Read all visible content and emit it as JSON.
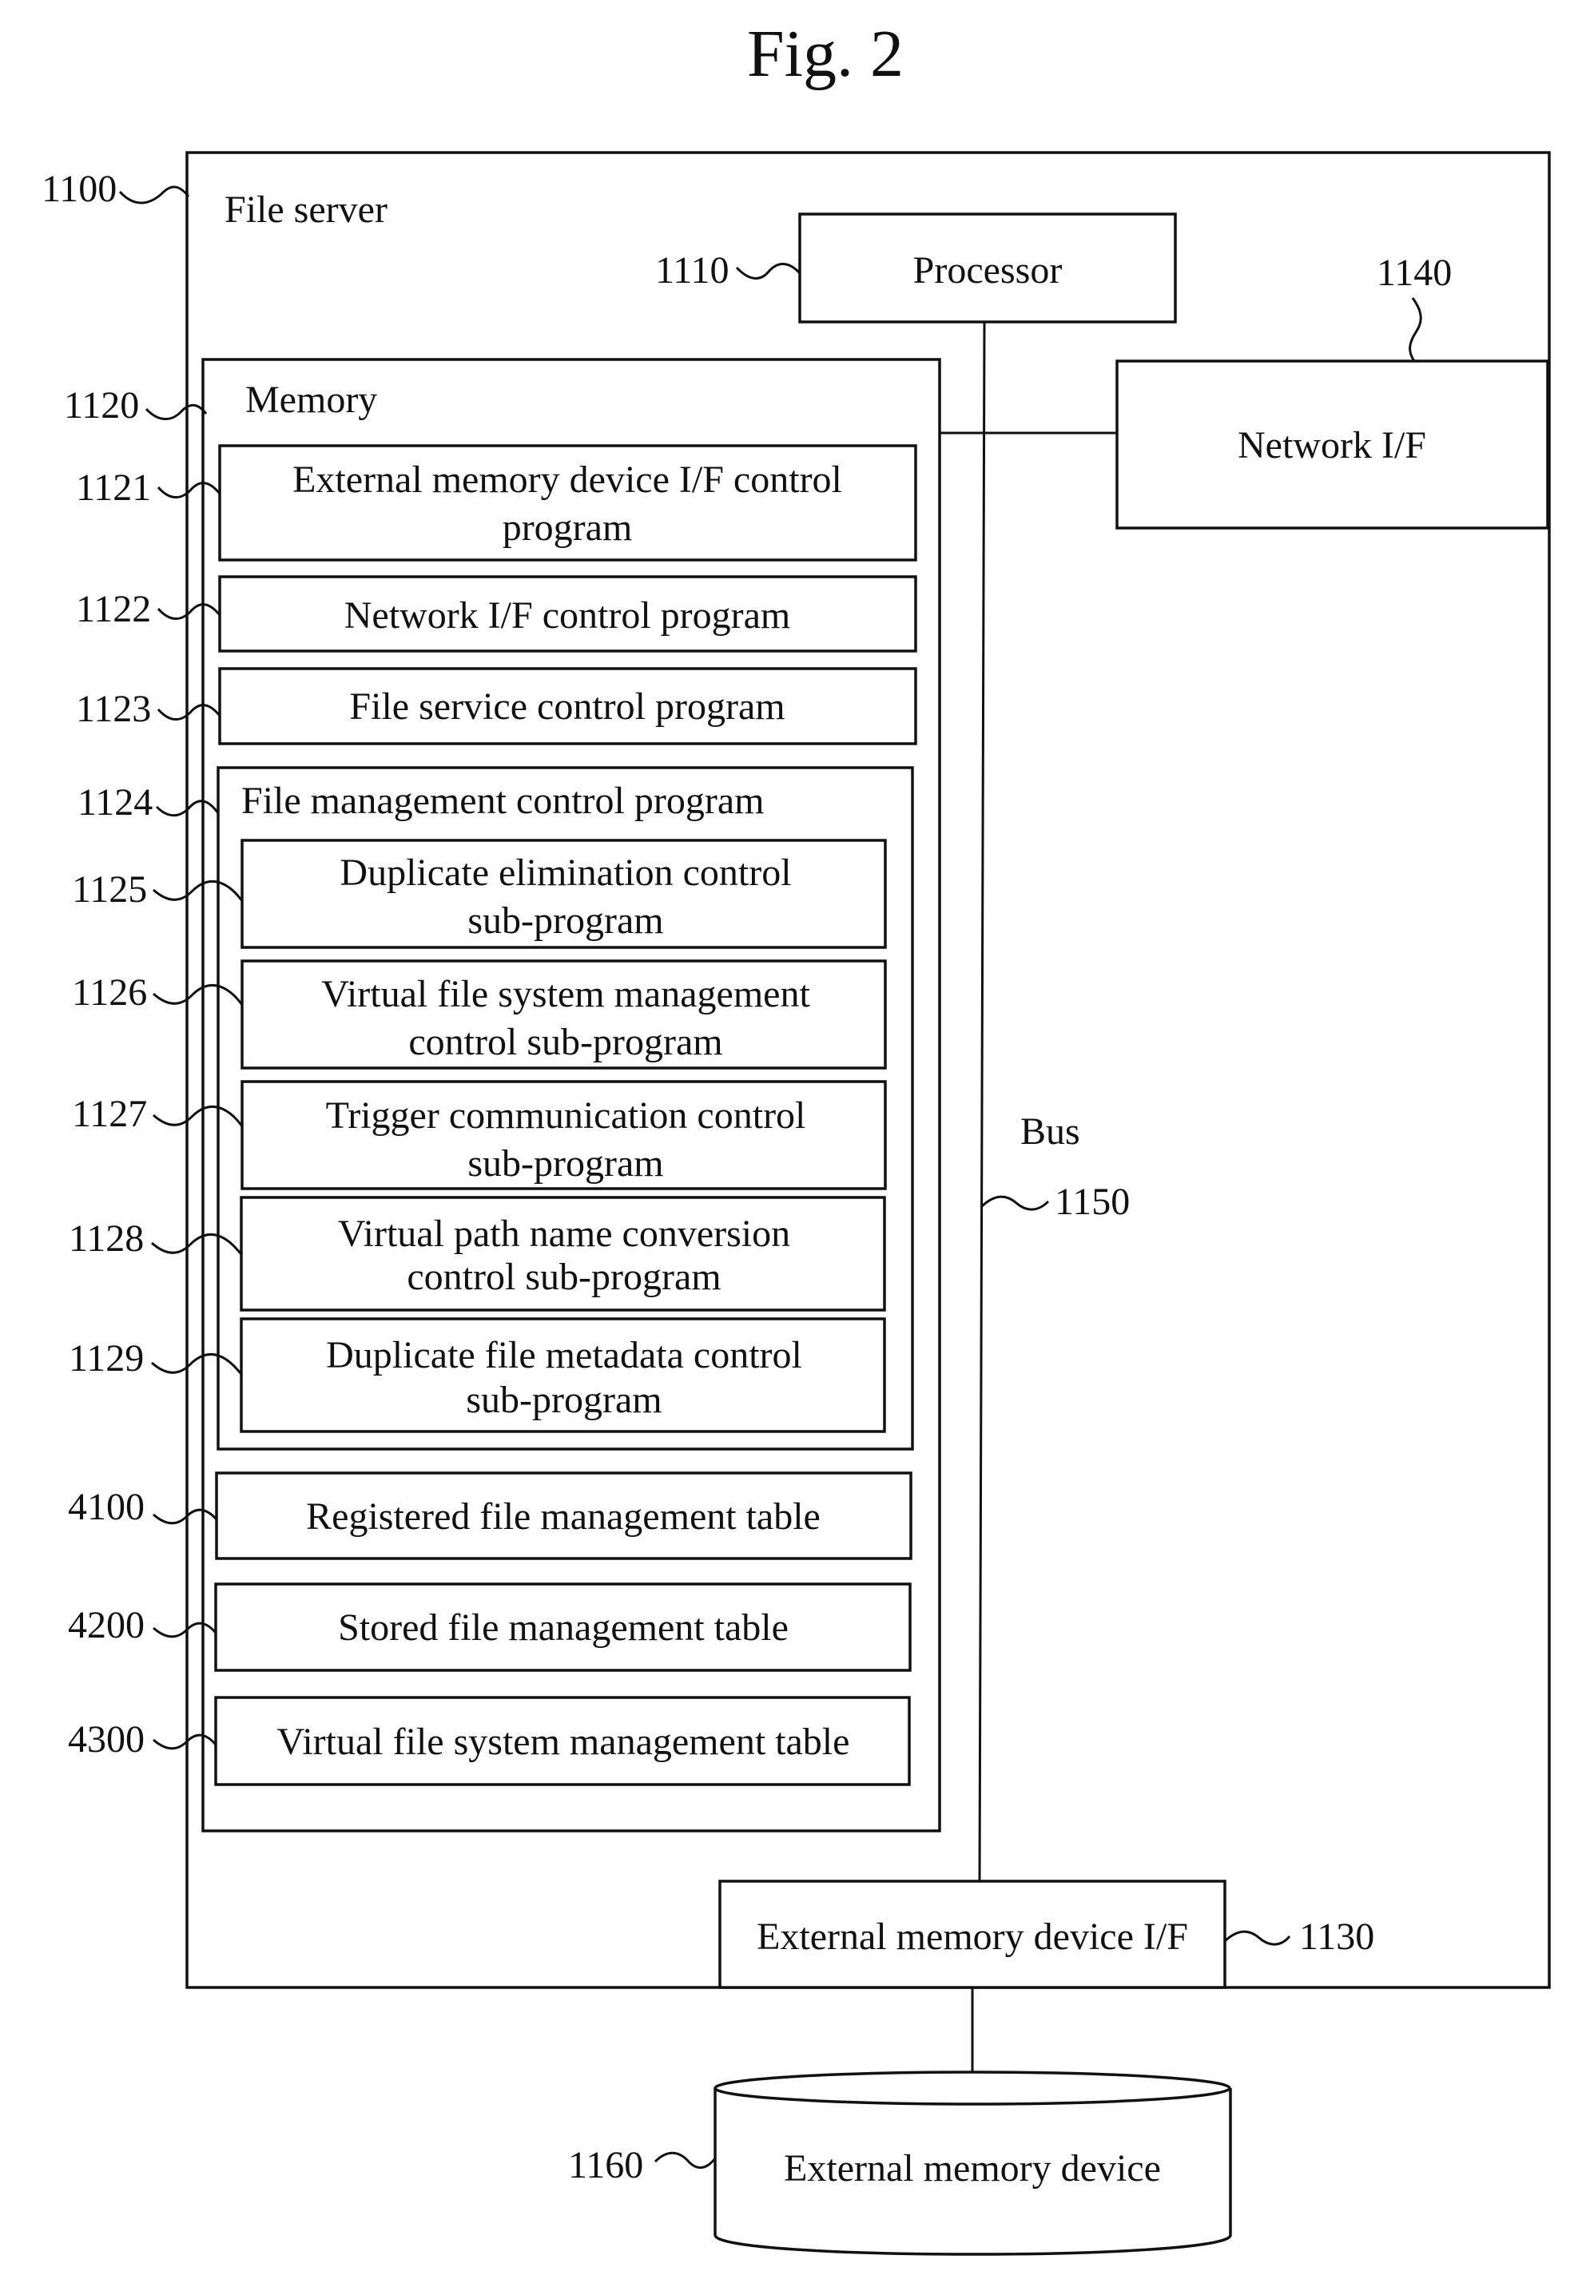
{
  "figure": {
    "title": "Fig. 2"
  },
  "file_server": {
    "ref": "1100",
    "label": "File server"
  },
  "processor": {
    "ref": "1110",
    "label": "Processor"
  },
  "network_if": {
    "ref": "1140",
    "label": "Network I/F"
  },
  "memory": {
    "ref": "1120",
    "label": "Memory",
    "programs": [
      {
        "ref": "1121",
        "lines": [
          "External memory device I/F control",
          "program"
        ]
      },
      {
        "ref": "1122",
        "lines": [
          "Network I/F control program"
        ]
      },
      {
        "ref": "1123",
        "lines": [
          "File service control program"
        ]
      }
    ],
    "file_management": {
      "ref": "1124",
      "label": "File management control program",
      "sub_programs": [
        {
          "ref": "1125",
          "lines": [
            "Duplicate elimination control",
            "sub-program"
          ]
        },
        {
          "ref": "1126",
          "lines": [
            "Virtual file system management",
            "control sub-program"
          ]
        },
        {
          "ref": "1127",
          "lines": [
            "Trigger communication control",
            "sub-program"
          ]
        },
        {
          "ref": "1128",
          "lines": [
            "Virtual path name conversion",
            "control sub-program"
          ]
        },
        {
          "ref": "1129",
          "lines": [
            "Duplicate file metadata control",
            "sub-program"
          ]
        }
      ]
    },
    "tables": [
      {
        "ref": "4100",
        "label": "Registered file management table"
      },
      {
        "ref": "4200",
        "label": "Stored file management table"
      },
      {
        "ref": "4300",
        "label": "Virtual file system management table"
      }
    ]
  },
  "bus": {
    "ref": "1150",
    "label": "Bus"
  },
  "external_memory_if": {
    "ref": "1130",
    "label": "External memory device I/F"
  },
  "external_memory_device": {
    "ref": "1160",
    "label": "External memory device"
  }
}
